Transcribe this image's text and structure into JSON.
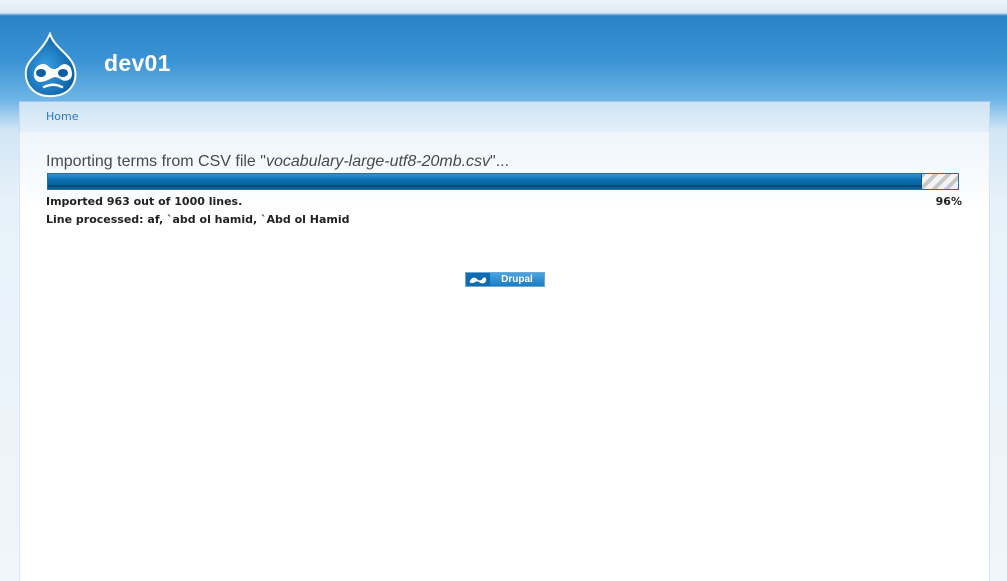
{
  "site": {
    "name": "dev01"
  },
  "nav": {
    "breadcrumb": "Home"
  },
  "progress": {
    "message_prefix": "Importing terms from CSV file \"",
    "file_name": "vocabulary-large-utf8-20mb.csv",
    "message_suffix": "\"...",
    "percent": 96,
    "percent_label": "96%",
    "status": "Imported 963 out of 1000 lines.",
    "line_processed": "Line processed: af, `abd ol hamid, `Abd ol Hamid"
  },
  "footer": {
    "powered_by_label": "Drupal"
  },
  "colors": {
    "header_blue": "#2a83c6",
    "bar_fill": "#0b6eae",
    "link": "#2a7ac0"
  }
}
